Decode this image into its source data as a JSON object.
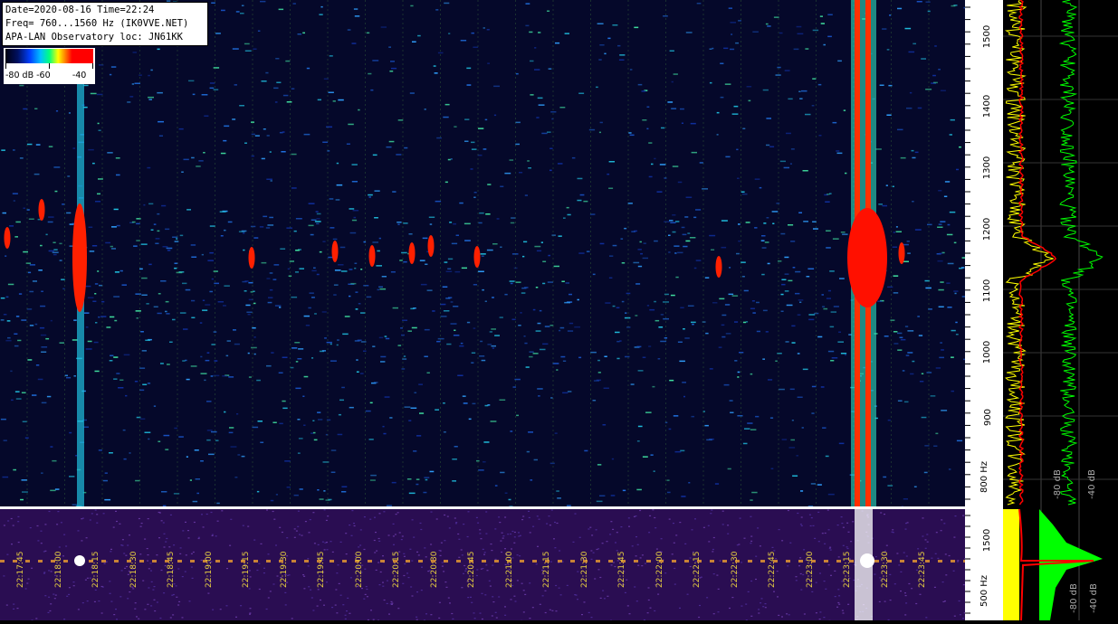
{
  "info": {
    "line1": "Date=2020-08-16 Time=22:24",
    "line2": "Freq= 760...1560 Hz (IK0VVE.NET)",
    "line3": "APA-LAN Observatory loc: JN61KK"
  },
  "legend": {
    "labels": [
      "-80 dB",
      "-60",
      "-40"
    ]
  },
  "freq_axis": {
    "upper_ticks": [
      "1500",
      "1400",
      "1300",
      "1200",
      "1100",
      "1000",
      "900",
      "800 Hz"
    ],
    "lower_ticks": [
      "1500",
      "500 Hz"
    ]
  },
  "spectrum_labels": {
    "upper_db_a": "-80 dB",
    "upper_db_b": "-40 dB",
    "lower_db_a": "-80 dB",
    "lower_db_b": "-40 dB"
  },
  "time_labels": [
    "22:17:45",
    "22:18:00",
    "22:18:15",
    "22:18:30",
    "22:18:45",
    "22:19:00",
    "22:19:15",
    "22:19:30",
    "22:19:45",
    "22:20:00",
    "22:20:15",
    "22:20:30",
    "22:20:45",
    "22:21:00",
    "22:21:15",
    "22:21:30",
    "22:21:45",
    "22:22:00",
    "22:22:15",
    "22:22:30",
    "22:22:45",
    "22:23:00",
    "22:23:15",
    "22:23:30",
    "22:23:45"
  ],
  "colors": {
    "upper_bg": "#05082a",
    "lower_bg": "#2a0d52",
    "spectrum_yellow": "#ffff00",
    "spectrum_red": "#ff0000",
    "spectrum_green": "#00ff00",
    "time_label": "#e8d040"
  }
}
